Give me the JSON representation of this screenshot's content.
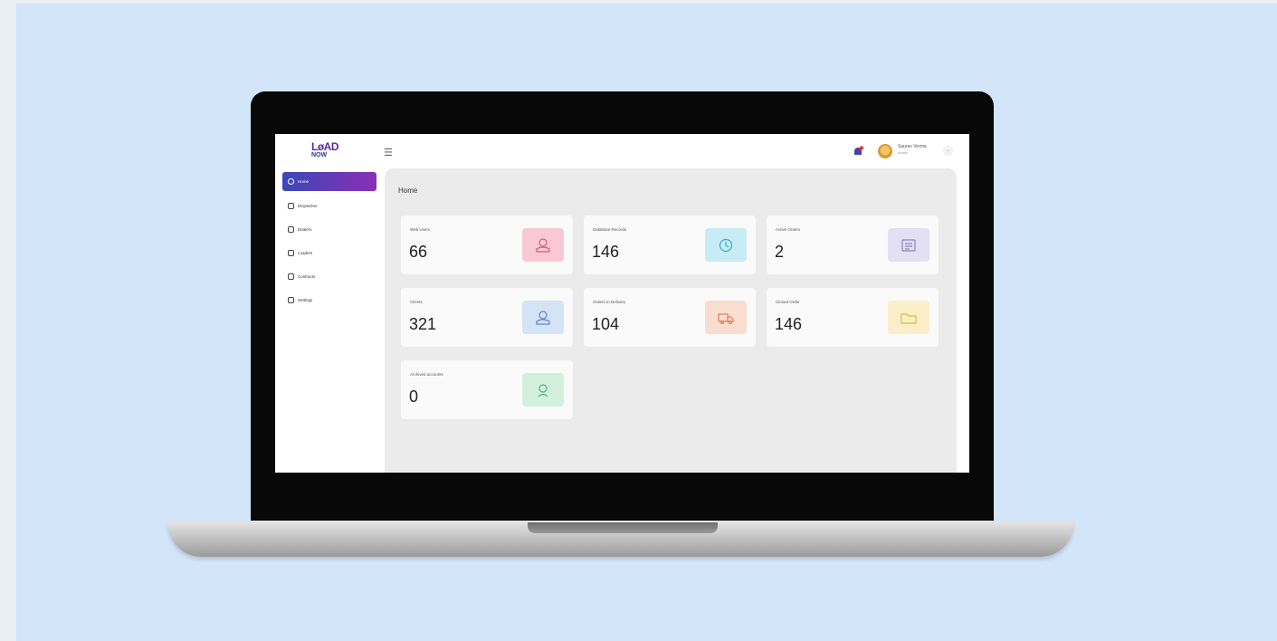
{
  "app": {
    "logo": {
      "line1": "LøAD",
      "line2": "NOW"
    },
    "user": {
      "name": "Saurav Verma",
      "role": "Admin"
    }
  },
  "sidebar": {
    "items": [
      {
        "label": "Home",
        "icon": "home-icon",
        "active": true
      },
      {
        "label": "Dispatcher",
        "icon": "dispatcher-icon",
        "active": false
      },
      {
        "label": "Dealers",
        "icon": "dealers-icon",
        "active": false
      },
      {
        "label": "Loaders",
        "icon": "loaders-icon",
        "active": false
      },
      {
        "label": "Contracts",
        "icon": "contracts-icon",
        "active": false
      },
      {
        "label": "Settings",
        "icon": "settings-icon",
        "active": false
      }
    ]
  },
  "main": {
    "title": "Home",
    "cards": [
      {
        "label": "Web Users",
        "value": "66",
        "icon": "user-icon",
        "color": "#f8c9d4",
        "stroke": "#e0557a"
      },
      {
        "label": "Database Records",
        "value": "146",
        "icon": "history-icon",
        "color": "#c8ecf6",
        "stroke": "#39a9cf"
      },
      {
        "label": "Active Orders",
        "value": "2",
        "icon": "list-icon",
        "color": "#e4e0f4",
        "stroke": "#8a82c4"
      },
      {
        "label": "Clients",
        "value": "321",
        "icon": "user-icon",
        "color": "#d5e3f7",
        "stroke": "#5b86d1"
      },
      {
        "label": "Orders In Delivery",
        "value": "104",
        "icon": "truck-icon",
        "color": "#f9ddd0",
        "stroke": "#e87b50"
      },
      {
        "label": "Closed Order",
        "value": "146",
        "icon": "folder-icon",
        "color": "#fbefc9",
        "stroke": "#e1b93a"
      },
      {
        "label": "Archived accounts",
        "value": "0",
        "icon": "archive-user-icon",
        "color": "#d3f0df",
        "stroke": "#4fb47a"
      }
    ]
  }
}
